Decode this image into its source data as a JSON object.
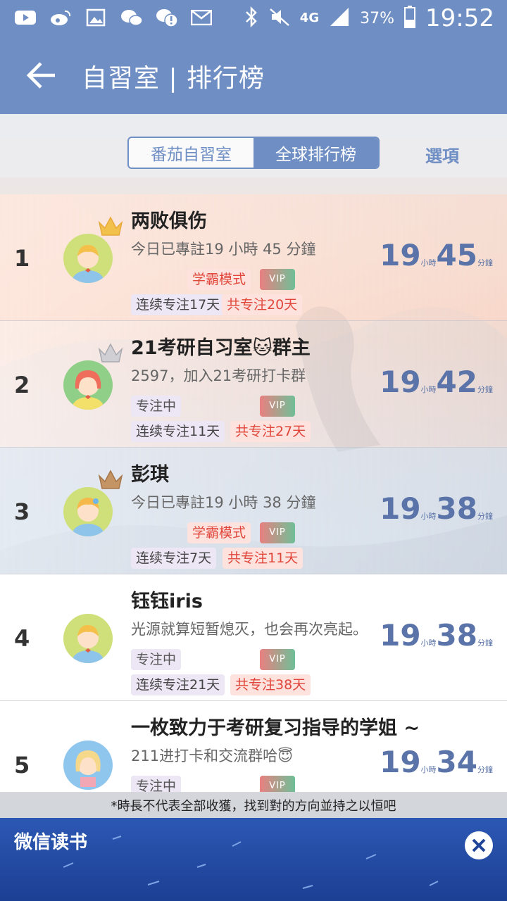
{
  "status_bar": {
    "network": "4G",
    "battery": "37%",
    "time": "19:52"
  },
  "app_bar": {
    "title": "自習室 | 排行榜"
  },
  "tabs": {
    "study_room": "番茄自習室",
    "global_rank": "全球排行榜",
    "options": "選項"
  },
  "entries": [
    {
      "rank": "1",
      "name": "两败俱伤",
      "motto": "今日已專註19 小時 45 分鐘",
      "mode": "学霸模式",
      "vip": "VIP",
      "streak": "连续专注17天",
      "total": "共专注20天",
      "hours": "19",
      "hours_unit": "小時",
      "minutes": "45",
      "minutes_unit": "分鐘"
    },
    {
      "rank": "2",
      "name": "21考研自习室🐱群主",
      "motto": "2597，加入21考研打卡群",
      "status": "专注中",
      "vip": "VIP",
      "streak": "连续专注11天",
      "total": "共专注27天",
      "hours": "19",
      "hours_unit": "小時",
      "minutes": "42",
      "minutes_unit": "分鐘"
    },
    {
      "rank": "3",
      "name": "彭琪",
      "motto": "今日已專註19 小時 38 分鐘",
      "mode": "学霸模式",
      "vip": "VIP",
      "streak": "连续专注7天",
      "total": "共专注11天",
      "hours": "19",
      "hours_unit": "小時",
      "minutes": "38",
      "minutes_unit": "分鐘"
    },
    {
      "rank": "4",
      "name": "钰钰iris",
      "motto": "光源就算短暂熄灭，也会再次亮起。",
      "status": "专注中",
      "vip": "VIP",
      "streak": "连续专注21天",
      "total": "共专注38天",
      "hours": "19",
      "hours_unit": "小時",
      "minutes": "38",
      "minutes_unit": "分鐘"
    },
    {
      "rank": "5",
      "name": "一枚致力于考研复习指导的学姐 ~",
      "motto": "211进打卡和交流群哈😇",
      "status": "专注中",
      "vip": "VIP",
      "hours": "19",
      "hours_unit": "小時",
      "minutes": "34",
      "minutes_unit": "分鐘"
    }
  ],
  "footer_note": "*時長不代表全部收獲，找到對的方向並持之以恒吧",
  "ad": {
    "title": "微信读书"
  }
}
